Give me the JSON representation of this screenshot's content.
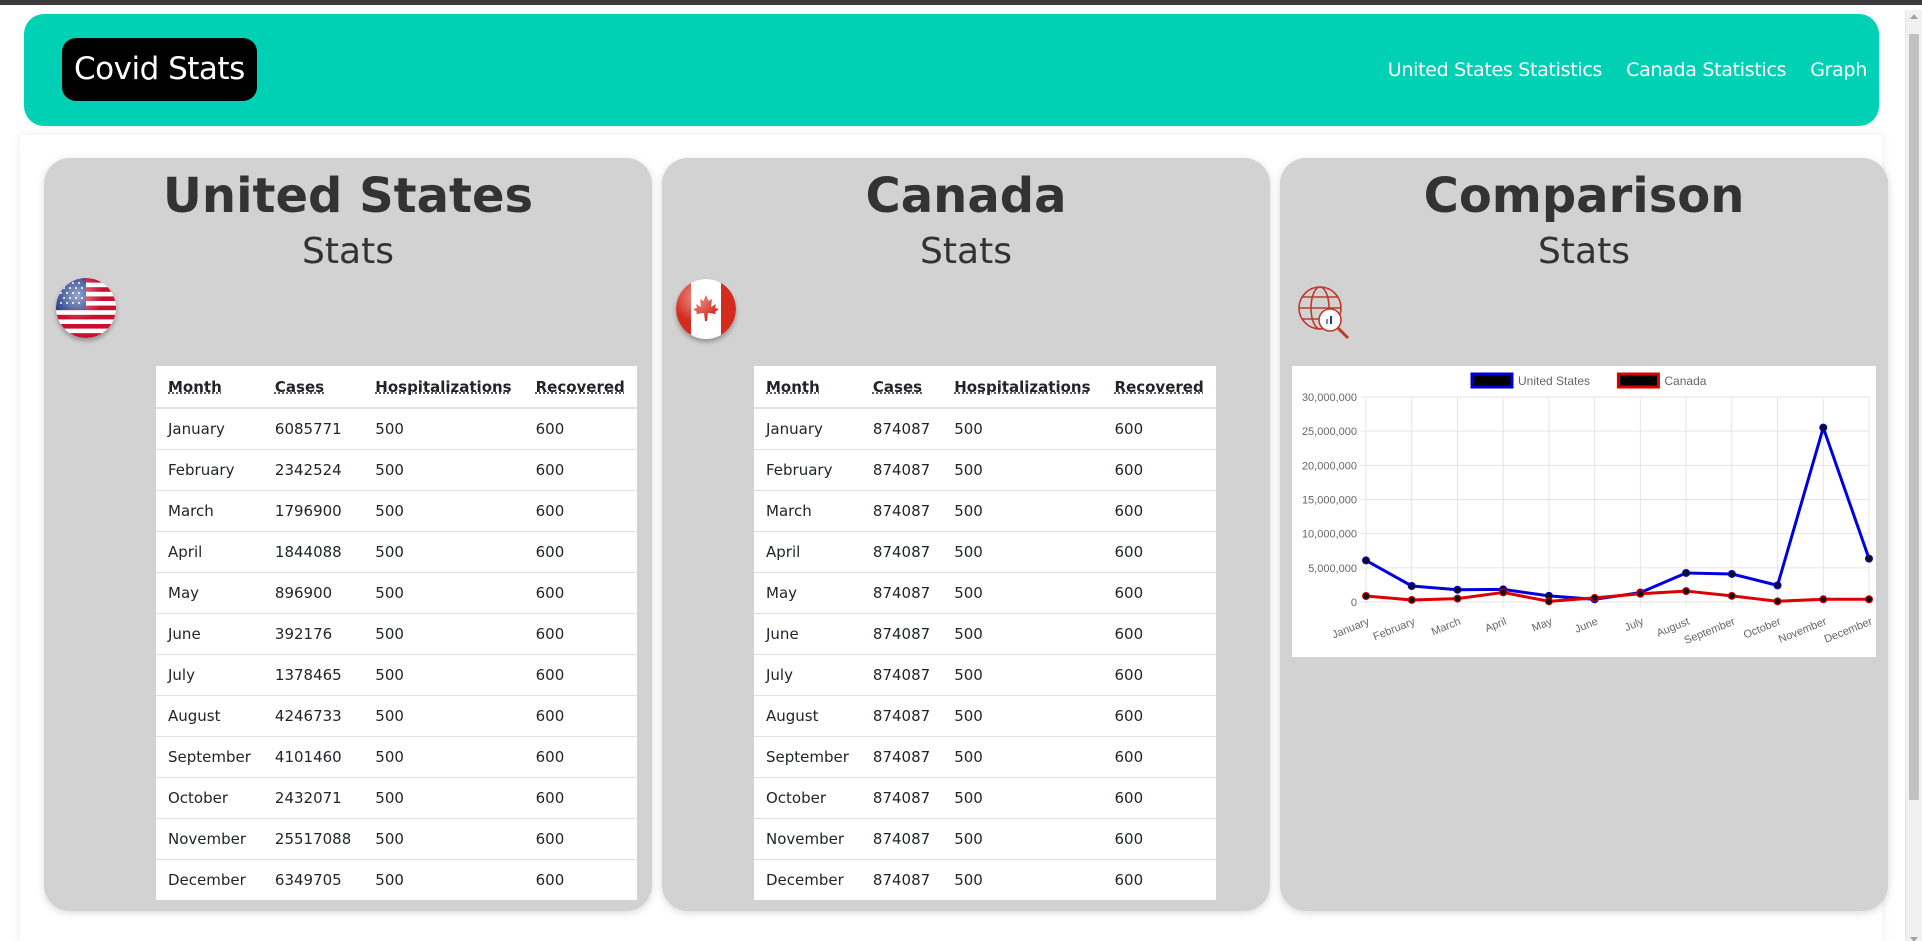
{
  "navbar": {
    "brand": "Covid Stats",
    "links": [
      "United States Statistics",
      "Canada Statistics",
      "Graph"
    ],
    "bg_color": "#00d1b5"
  },
  "us_card": {
    "title": "United States",
    "subtitle": "Stats",
    "table": {
      "headers": [
        "Month",
        "Cases",
        "Hospitalizations",
        "Recovered"
      ],
      "rows": [
        [
          "January",
          "6085771",
          "500",
          "600"
        ],
        [
          "February",
          "2342524",
          "500",
          "600"
        ],
        [
          "March",
          "1796900",
          "500",
          "600"
        ],
        [
          "April",
          "1844088",
          "500",
          "600"
        ],
        [
          "May",
          "896900",
          "500",
          "600"
        ],
        [
          "June",
          "392176",
          "500",
          "600"
        ],
        [
          "July",
          "1378465",
          "500",
          "600"
        ],
        [
          "August",
          "4246733",
          "500",
          "600"
        ],
        [
          "September",
          "4101460",
          "500",
          "600"
        ],
        [
          "October",
          "2432071",
          "500",
          "600"
        ],
        [
          "November",
          "25517088",
          "500",
          "600"
        ],
        [
          "December",
          "6349705",
          "500",
          "600"
        ]
      ]
    }
  },
  "canada_card": {
    "title": "Canada",
    "subtitle": "Stats",
    "table": {
      "headers": [
        "Month",
        "Cases",
        "Hospitalizations",
        "Recovered"
      ],
      "rows": [
        [
          "January",
          "874087",
          "500",
          "600"
        ],
        [
          "February",
          "874087",
          "500",
          "600"
        ],
        [
          "March",
          "874087",
          "500",
          "600"
        ],
        [
          "April",
          "874087",
          "500",
          "600"
        ],
        [
          "May",
          "874087",
          "500",
          "600"
        ],
        [
          "June",
          "874087",
          "500",
          "600"
        ],
        [
          "July",
          "874087",
          "500",
          "600"
        ],
        [
          "August",
          "874087",
          "500",
          "600"
        ],
        [
          "September",
          "874087",
          "500",
          "600"
        ],
        [
          "October",
          "874087",
          "500",
          "600"
        ],
        [
          "November",
          "874087",
          "500",
          "600"
        ],
        [
          "December",
          "874087",
          "500",
          "600"
        ]
      ]
    }
  },
  "comparison_card": {
    "title": "Comparison",
    "subtitle": "Stats",
    "icon": "globe-search-icon"
  },
  "chart_data": {
    "type": "line",
    "categories": [
      "January",
      "February",
      "March",
      "April",
      "May",
      "June",
      "July",
      "August",
      "September",
      "October",
      "November",
      "December"
    ],
    "series": [
      {
        "name": "United States",
        "color": "#0000dd",
        "values": [
          6085771,
          2342524,
          1796900,
          1844088,
          896900,
          392176,
          1378465,
          4246733,
          4101460,
          2432071,
          25517088,
          6349705
        ]
      },
      {
        "name": "Canada",
        "color": "#dd0000",
        "values": [
          874087,
          300000,
          500000,
          1400000,
          100000,
          600000,
          1200000,
          1600000,
          900000,
          100000,
          400000,
          400000
        ]
      }
    ],
    "ylim": [
      0,
      30000000
    ],
    "yticks": [
      "30,000,000",
      "25,000,000",
      "20,000,000",
      "15,000,000",
      "10,000,000",
      "5,000,000",
      "0"
    ],
    "grid": true,
    "legend": "top"
  }
}
